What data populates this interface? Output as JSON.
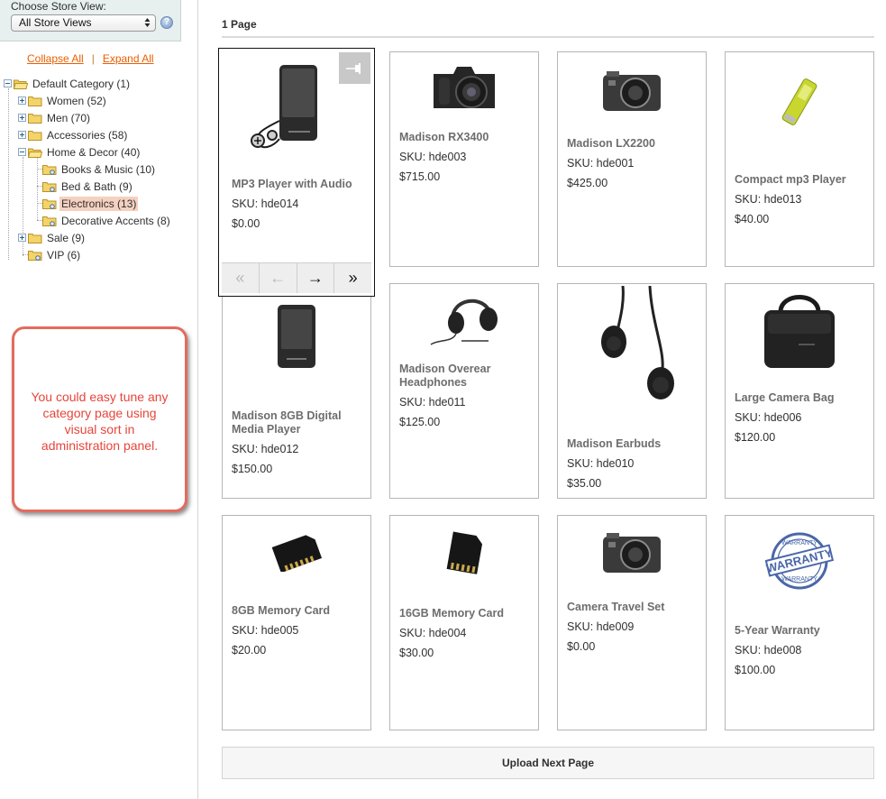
{
  "store": {
    "label": "Choose Store View:",
    "selected": "All Store Views"
  },
  "tree_links": {
    "collapse": "Collapse All",
    "separator": "|",
    "expand": "Expand All"
  },
  "tree": [
    {
      "label": "Default Category (1)"
    },
    {
      "label": "Women (52)"
    },
    {
      "label": "Men (70)"
    },
    {
      "label": "Accessories (58)"
    },
    {
      "label": "Home & Decor (40)"
    },
    {
      "label": "Books & Music (10)"
    },
    {
      "label": "Bed & Bath (9)"
    },
    {
      "label": "Electronics (13)"
    },
    {
      "label": "Decorative Accents (8)"
    },
    {
      "label": "Sale (9)"
    },
    {
      "label": "VIP (6)"
    }
  ],
  "callout": {
    "text": "You could easy tune any category page using visual sort in administration panel."
  },
  "page_heading": "1 Page",
  "products": [
    {
      "name": "MP3 Player with Audio",
      "sku": "SKU: hde014",
      "price": "$0.00",
      "icon": "mp3-player-image"
    },
    {
      "name": "Madison RX3400",
      "sku": "SKU: hde003",
      "price": "$715.00",
      "icon": "dslr-camera-image"
    },
    {
      "name": "Madison LX2200",
      "sku": "SKU: hde001",
      "price": "$425.00",
      "icon": "compact-camera-image"
    },
    {
      "name": "Compact mp3 Player",
      "sku": "SKU: hde013",
      "price": "$40.00",
      "icon": "usb-mp3-image"
    },
    {
      "name": "Madison 8GB Digital Media Player",
      "sku": "SKU: hde012",
      "price": "$150.00",
      "icon": "media-player-image"
    },
    {
      "name": "Madison Overear Headphones",
      "sku": "SKU: hde011",
      "price": "$125.00",
      "icon": "headphones-image"
    },
    {
      "name": "Madison Earbuds",
      "sku": "SKU: hde010",
      "price": "$35.00",
      "icon": "earbuds-image"
    },
    {
      "name": "Large Camera Bag",
      "sku": "SKU: hde006",
      "price": "$120.00",
      "icon": "camera-bag-image"
    },
    {
      "name": "8GB Memory Card",
      "sku": "SKU: hde005",
      "price": "$20.00",
      "icon": "memory-card-image"
    },
    {
      "name": "16GB Memory Card",
      "sku": "SKU: hde004",
      "price": "$30.00",
      "icon": "memory-card-image"
    },
    {
      "name": "Camera Travel Set",
      "sku": "SKU: hde009",
      "price": "$0.00",
      "icon": "compact-camera-image"
    },
    {
      "name": "5-Year Warranty",
      "sku": "SKU: hde008",
      "price": "$100.00",
      "icon": "warranty-stamp-image"
    }
  ],
  "warranty_stamp": {
    "top": "WARRANTY",
    "main": "WARRANTY",
    "bottom": "WARRANTY"
  },
  "nav_icons": [
    "double-left-arrow-icon",
    "left-arrow-icon",
    "right-arrow-icon",
    "double-right-arrow-icon"
  ],
  "upload_button": "Upload Next Page",
  "colors": {
    "link": "#eb5e00",
    "callout_border": "#e46b5d",
    "callout_text": "#e6453a",
    "selected_node": "#f5d1c0"
  }
}
